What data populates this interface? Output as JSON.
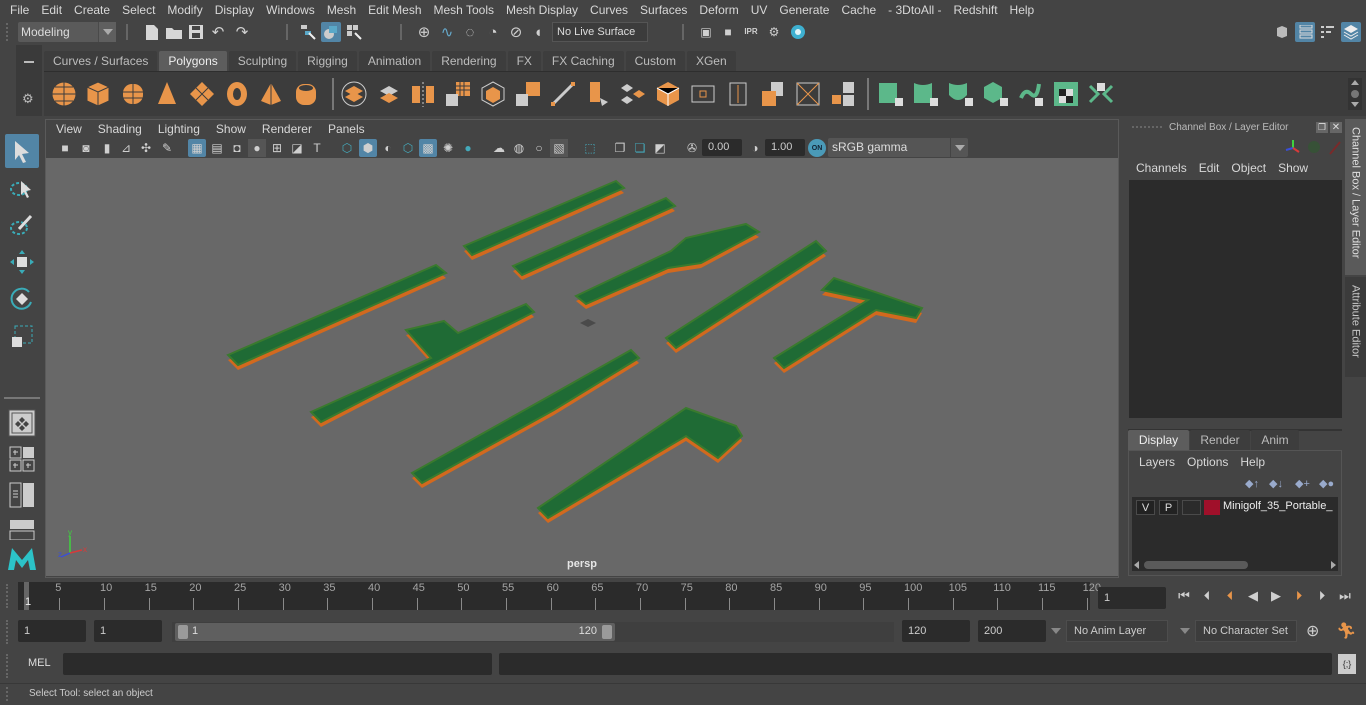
{
  "menubar": {
    "items": [
      "File",
      "Edit",
      "Create",
      "Select",
      "Modify",
      "Display",
      "Windows",
      "Mesh",
      "Edit Mesh",
      "Mesh Tools",
      "Mesh Display",
      "Curves",
      "Surfaces",
      "Deform",
      "UV",
      "Generate",
      "Cache",
      "- 3DtoAll -",
      "Redshift",
      "Help"
    ]
  },
  "statusline": {
    "workspace": "Modeling",
    "live_surface": "No Live Surface",
    "icons": [
      "new-scene-icon",
      "open-scene-icon",
      "save-scene-icon",
      "undo-icon",
      "redo-icon",
      "select-by-hierarchy-icon",
      "select-by-object-icon",
      "select-by-component-icon",
      "snap-grid-icon",
      "snap-curve-icon",
      "snap-point-icon",
      "snap-view-plane-icon",
      "snap-live-icon",
      "snap-surface-icon",
      "render-view-icon",
      "render-current-icon",
      "ipr-render-icon",
      "render-settings-icon",
      "hypershade-icon"
    ],
    "right_icons": [
      "modeling-toolkit-icon",
      "attribute-editor-toggle-icon",
      "tool-settings-icon",
      "channel-box-toggle-icon"
    ]
  },
  "shelf": {
    "tabs": [
      "Curves / Surfaces",
      "Polygons",
      "Sculpting",
      "Rigging",
      "Animation",
      "Rendering",
      "FX",
      "FX Caching",
      "Custom",
      "XGen"
    ],
    "active_tab": "Polygons",
    "icons": [
      "poly-sphere",
      "poly-cube",
      "poly-cylinder",
      "poly-cone",
      "poly-plane",
      "poly-torus",
      "poly-pyramid",
      "poly-pipe",
      "combine",
      "separate",
      "mirror",
      "smooth",
      "extract",
      "bevel",
      "bridge",
      "extrude",
      "insert-edge-loop",
      "multi-cut",
      "target-weld",
      "append",
      "merge",
      "fill-hole",
      "uv-planar",
      "uv-cylindrical",
      "uv-spherical",
      "uv-automatic",
      "uv-unfold",
      "uv-editor",
      "uv-layout"
    ]
  },
  "toolbox": {
    "tools": [
      "select-tool",
      "lasso-tool",
      "paint-select-tool",
      "move-tool",
      "rotate-tool",
      "scale-tool"
    ],
    "layouts": [
      "single-pane-layout",
      "four-pane-layout",
      "side-by-side-layout",
      "top-bottom-layout"
    ]
  },
  "viewport": {
    "menu": [
      "View",
      "Shading",
      "Lighting",
      "Show",
      "Renderer",
      "Panels"
    ],
    "exposure": "0.00",
    "gamma": "1.00",
    "color_mgmt": "ON",
    "color_space": "sRGB gamma",
    "camera_label": "persp",
    "axis": {
      "x": "x",
      "y": "y",
      "z": "z"
    },
    "scene_colors": {
      "bg": "#686868",
      "green": "#1f6b35",
      "rim": "#3a7a2e",
      "orange": "#d2691e"
    }
  },
  "channelbox": {
    "title": "Channel Box / Layer Editor",
    "menu": [
      "Channels",
      "Edit",
      "Object",
      "Show"
    ],
    "layer_tabs": [
      "Display",
      "Render",
      "Anim"
    ],
    "active_layer_tab": "Display",
    "layer_menu": [
      "Layers",
      "Options",
      "Help"
    ],
    "layers": [
      {
        "v": "V",
        "p": "P",
        "color": "#a0102a",
        "name": "Minigolf_35_Portable_"
      }
    ]
  },
  "sidetabs": [
    "Channel Box / Layer Editor",
    "Attribute Editor"
  ],
  "timeline": {
    "ticks": [
      5,
      10,
      15,
      20,
      25,
      30,
      35,
      40,
      45,
      50,
      55,
      60,
      65,
      70,
      75,
      80,
      85,
      90,
      95,
      100,
      105,
      110,
      115,
      120
    ],
    "current_marker": "1",
    "current_frame": "1",
    "start_frame": "1",
    "range_start": "1",
    "slider_start": "1",
    "slider_end": "120",
    "range_end": "120",
    "end_frame": "200",
    "anim_layer": "No Anim Layer",
    "character_set": "No Character Set"
  },
  "command": {
    "label": "MEL",
    "input": "",
    "output": ""
  },
  "status": {
    "message": "Select Tool: select an object"
  }
}
